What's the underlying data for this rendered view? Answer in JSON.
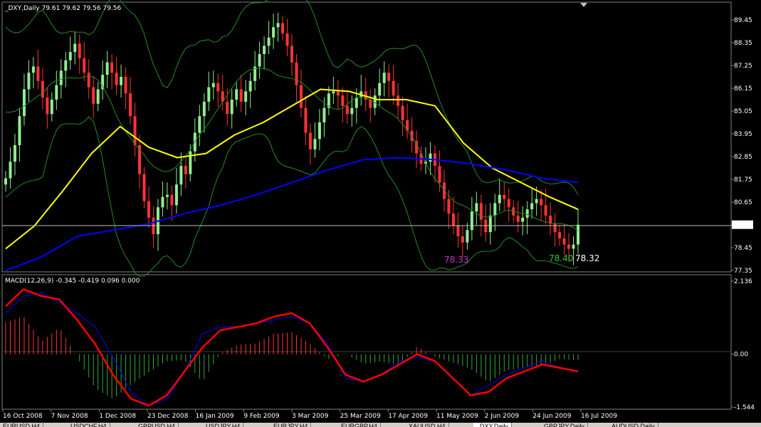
{
  "main_title": "_DXY,Daily  79.61 79.62 79.56 79.56",
  "macd_title": "MACD(12,26,9) -0.345 -0.419 0.096 0.000",
  "price_axis": {
    "ticks": [
      "89.45",
      "88.35",
      "87.25",
      "86.15",
      "85.05",
      "83.95",
      "82.85",
      "81.75",
      "80.65",
      "79.56",
      "78.45",
      "77.35"
    ],
    "current": "79.56"
  },
  "macd_axis": {
    "ticks": [
      "2.136",
      "0.00",
      "-1.544"
    ]
  },
  "date_axis": [
    "16 Oct 2008",
    "7 Nov 2008",
    "1 Dec 2008",
    "23 Dec 2008",
    "16 Jan 2009",
    "9 Feb 2009",
    "3 Mar 2009",
    "25 Mar 2009",
    "17 Apr 2009",
    "11 May 2009",
    "2 Jun 2009",
    "24 Jun 2009",
    "16 Jul 2009"
  ],
  "annotations": [
    {
      "text": "78.33",
      "color": "#cc33cc"
    },
    {
      "text": "78.40",
      "color": "#33cc33"
    },
    {
      "text": "78.32",
      "color": "#ffffff"
    }
  ],
  "tabs": [
    "EURUSD,H4",
    "USDCHF,H4",
    "GBPUSD,H4",
    "USDJPY,H4",
    "EURJPY,H4",
    "EURGBP,H4",
    "XAUUSD,H4",
    "_DXY,Daily",
    "GBPJPY,Daily",
    "AUDUSD,Daily"
  ],
  "chart_data": {
    "type": "candlestick",
    "symbol": "_DXY",
    "timeframe": "Daily",
    "ohlc": {
      "open": 79.61,
      "high": 79.62,
      "low": 79.56,
      "close": 79.56
    },
    "ylim": [
      77.35,
      89.45
    ],
    "closes": [
      81.8,
      82.6,
      83.4,
      84.8,
      86.1,
      86.9,
      87.2,
      86.5,
      85.7,
      84.9,
      85.6,
      86.3,
      87.0,
      87.5,
      87.9,
      88.3,
      87.6,
      86.9,
      86.2,
      85.4,
      86.1,
      86.8,
      87.4,
      86.9,
      86.3,
      86.7,
      85.9,
      84.8,
      83.4,
      82.0,
      80.7,
      79.9,
      79.1,
      80.4,
      80.9,
      81.0,
      80.5,
      81.5,
      82.4,
      82.0,
      83.1,
      84.0,
      84.8,
      85.5,
      86.2,
      86.4,
      86.0,
      85.5,
      84.9,
      85.6,
      86.1,
      85.5,
      86.0,
      86.5,
      87.2,
      87.8,
      88.2,
      88.6,
      89.1,
      89.3,
      88.8,
      88.2,
      87.4,
      86.3,
      85.2,
      84.0,
      83.2,
      83.7,
      84.5,
      85.2,
      85.9,
      86.0,
      85.8,
      85.3,
      84.9,
      85.2,
      85.7,
      86.0,
      85.6,
      85.2,
      85.8,
      86.4,
      86.9,
      86.5,
      85.8,
      85.3,
      84.6,
      84.1,
      83.6,
      83.0,
      82.5,
      82.6,
      83.0,
      82.4,
      81.6,
      80.8,
      80.1,
      79.5,
      79.0,
      78.7,
      79.3,
      80.2,
      80.6,
      79.8,
      79.2,
      80.0,
      80.6,
      81.0,
      80.8,
      80.4,
      80.0,
      79.7,
      79.9,
      80.3,
      80.6,
      80.8,
      80.5,
      80.0,
      79.6,
      79.2,
      78.9,
      78.6,
      78.4,
      78.6,
      79.56
    ],
    "moving_averages": [
      {
        "color": "#ffff00",
        "values": [
          78.4,
          79.5,
          81.2,
          83.0,
          84.3,
          83.3,
          82.8,
          83.0,
          83.9,
          84.5,
          85.3,
          86.1,
          86.0,
          85.6,
          85.6,
          85.3,
          83.5,
          82.3,
          81.6,
          80.9,
          80.3
        ]
      },
      {
        "color": "#0000ff",
        "values": [
          77.35,
          78.0,
          79.0,
          79.3,
          79.6,
          80.1,
          80.5,
          81.0,
          81.6,
          82.2,
          82.7,
          82.8,
          82.7,
          82.5,
          82.2,
          81.8,
          81.6
        ]
      }
    ],
    "bollinger": {
      "color": "#228b22"
    },
    "macd": {
      "params": [
        12,
        26,
        9
      ],
      "values": {
        "main": -0.345,
        "signal": -0.419,
        "histogram": 0.096,
        "level": 0.0
      },
      "ylim": [
        -1.544,
        2.136
      ],
      "main_line": [
        1.4,
        1.9,
        1.7,
        1.6,
        1.0,
        0.3,
        -0.6,
        -1.3,
        -1.5,
        -1.2,
        -0.5,
        0.2,
        0.7,
        0.8,
        0.9,
        1.1,
        1.2,
        0.9,
        0.2,
        -0.6,
        -0.8,
        -0.6,
        -0.3,
        0.0,
        -0.2,
        -0.7,
        -1.2,
        -1.1,
        -0.7,
        -0.5,
        -0.3,
        -0.4,
        -0.5
      ],
      "signal_line": [
        1.2,
        1.7,
        1.8,
        1.5,
        1.2,
        0.8,
        -0.1,
        -1.1,
        -1.5,
        -1.3,
        -0.5,
        0.6,
        0.8,
        0.8,
        0.9,
        1.0,
        1.1,
        0.9,
        0.3,
        -0.7,
        -0.8,
        -0.6,
        -0.2,
        -0.1,
        -0.2,
        -0.7,
        -1.2,
        -0.9,
        -0.6,
        -0.4,
        -0.2,
        -0.4,
        -0.5
      ]
    }
  },
  "colors": {
    "background": "#000000",
    "grid": "#808080",
    "bull_candle": "#90ee90",
    "bear_candle": "#ff3333",
    "macd_main": "#ff0000",
    "macd_signal": "#0000ff",
    "hist_pos": "#ff3333",
    "hist_neg": "#33aa33",
    "current_price_line": "#c0c0c0"
  }
}
